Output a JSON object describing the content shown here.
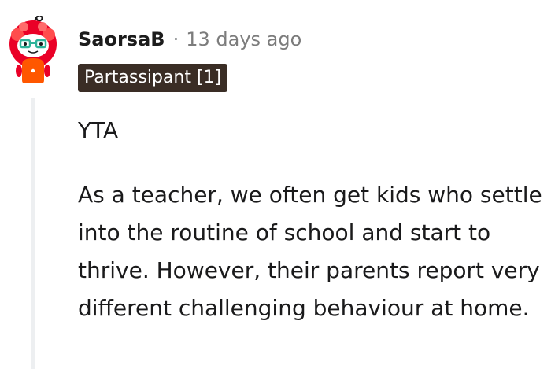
{
  "comment": {
    "author": "SaorsaB",
    "separator": "·",
    "timestamp": "13 days ago",
    "flair": "Partassipant [1]",
    "paragraphs": [
      "YTA",
      "As a teacher, we often get kids who settle into the routine of school and start to thrive. However, their parents report very different challenging behaviour at home."
    ]
  },
  "colors": {
    "flair_background": "#3a2d25",
    "thread_line": "#edeff1",
    "avatar_red": "#ea0027",
    "avatar_shirt": "#ff5700",
    "avatar_glasses": "#2fb39a"
  },
  "icons": {
    "avatar": "reddit-snoo-avatar"
  }
}
